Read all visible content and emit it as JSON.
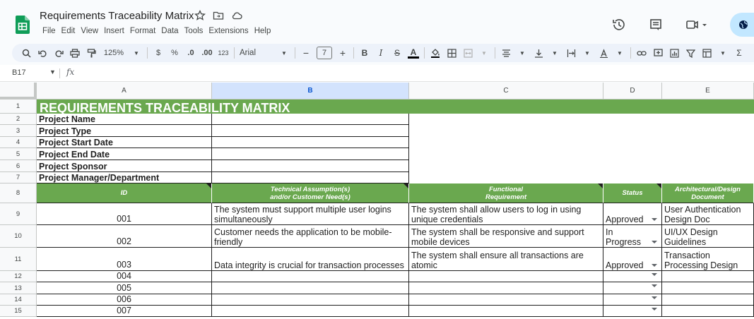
{
  "app": {
    "doc_title": "Requirements Traceability Matrix",
    "menu": [
      "File",
      "Edit",
      "View",
      "Insert",
      "Format",
      "Data",
      "Tools",
      "Extensions",
      "Help"
    ]
  },
  "toolbar": {
    "zoom": "125%",
    "currency": "$",
    "percent": "%",
    "dec_decrease": ".0",
    "dec_increase": ".00",
    "number_format": "123",
    "font": "Arial",
    "font_size": "7",
    "minus": "−",
    "plus": "+",
    "bold": "B",
    "italic": "I",
    "strike": "S",
    "text_color": "A",
    "sigma": "Σ"
  },
  "formula_bar": {
    "name_box": "B17",
    "fx": "fx"
  },
  "columns": [
    "A",
    "B",
    "C",
    "D",
    "E"
  ],
  "rows": [
    "1",
    "2",
    "3",
    "4",
    "5",
    "6",
    "7",
    "8",
    "9",
    "10",
    "11",
    "12",
    "13",
    "14",
    "15"
  ],
  "sheet": {
    "title": "REQUIREMENTS TRACEABILITY MATRIX",
    "info_labels": [
      "Project Name",
      "Project Type",
      "Project Start Date",
      "Project End Date",
      "Project Sponsor",
      "Project Manager/Department"
    ],
    "headers": {
      "id": "ID",
      "tech_line1": "Technical Assumption(s)",
      "tech_line2": "and/or Customer Need(s)",
      "func_line1": "Functional",
      "func_line2": "Requirement",
      "status": "Status",
      "arch_line1": "Architectural/Design",
      "arch_line2": "Document"
    },
    "requirements": [
      {
        "id": "001",
        "tech": "The system must support multiple user logins simultaneously",
        "func": "The system shall allow users to log in using unique credentials",
        "status": "Approved",
        "doc": "User Authentication Design Doc"
      },
      {
        "id": "002",
        "tech": "Customer needs the application to be mobile-friendly",
        "func": "The system shall be responsive and support mobile devices",
        "status": "In Progress",
        "doc": "UI/UX Design Guidelines"
      },
      {
        "id": "003",
        "tech": "Data integrity is crucial for transaction processes",
        "func": "The system shall ensure all transactions are atomic",
        "status": "Approved",
        "doc": "Transaction Processing Design"
      },
      {
        "id": "004",
        "tech": "",
        "func": "",
        "status": "",
        "doc": ""
      },
      {
        "id": "005",
        "tech": "",
        "func": "",
        "status": "",
        "doc": ""
      },
      {
        "id": "006",
        "tech": "",
        "func": "",
        "status": "",
        "doc": ""
      },
      {
        "id": "007",
        "tech": "",
        "func": "",
        "status": "",
        "doc": ""
      }
    ]
  },
  "colors": {
    "header_green": "#6aa84f",
    "selected_col": "#d3e3fd",
    "share_blue": "#c2e7ff"
  }
}
